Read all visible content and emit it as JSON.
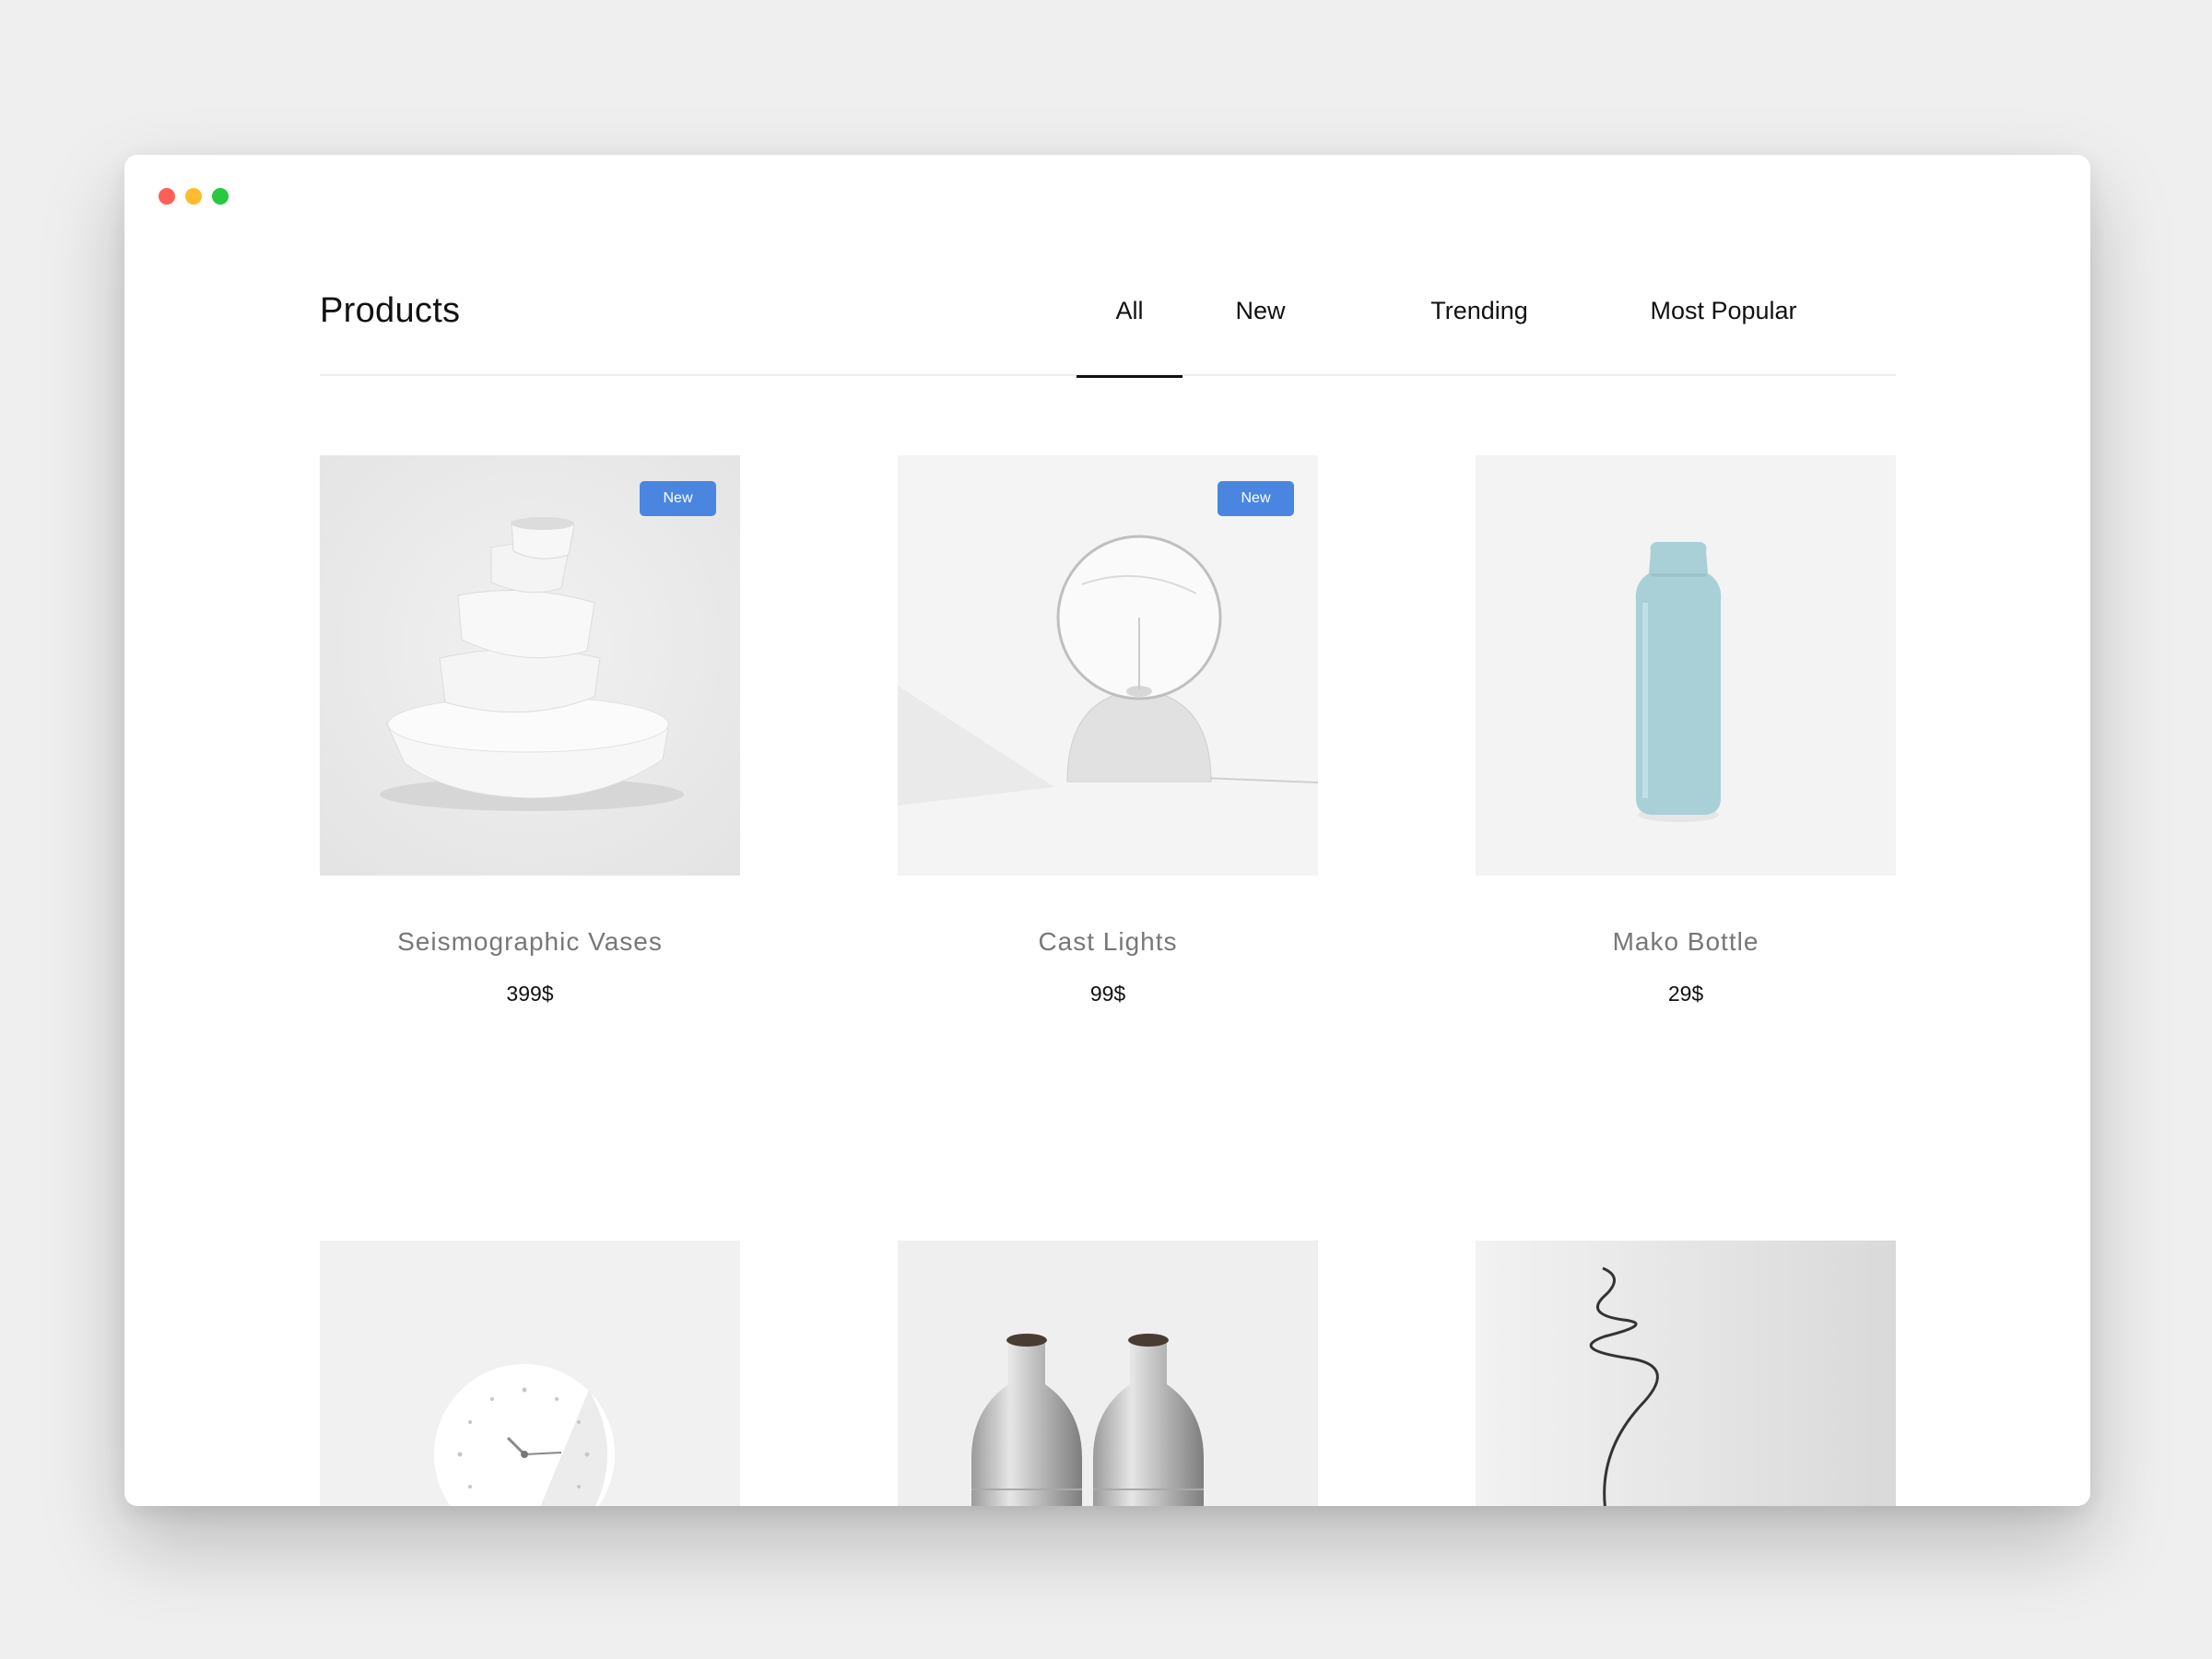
{
  "page": {
    "title": "Products"
  },
  "tabs": [
    {
      "label": "All",
      "active": true
    },
    {
      "label": "New",
      "active": false
    },
    {
      "label": "Trending",
      "active": false
    },
    {
      "label": "Most Popular",
      "active": false
    }
  ],
  "products": [
    {
      "name": "Seismographic Vases",
      "price": "399$",
      "badge": "New",
      "image": "vase-image"
    },
    {
      "name": "Cast Lights",
      "price": "99$",
      "badge": "New",
      "image": "lamp-image"
    },
    {
      "name": "Mako Bottle",
      "price": "29$",
      "badge": "",
      "image": "bottle-image"
    },
    {
      "name": "",
      "price": "",
      "badge": "",
      "image": "clock-image"
    },
    {
      "name": "",
      "price": "",
      "badge": "",
      "image": "grinders-image"
    },
    {
      "name": "",
      "price": "",
      "badge": "",
      "image": "wire-lamp-image"
    }
  ],
  "colors": {
    "badge": "#4a86e0",
    "accent_text": "#111111",
    "muted_text": "#777777"
  }
}
